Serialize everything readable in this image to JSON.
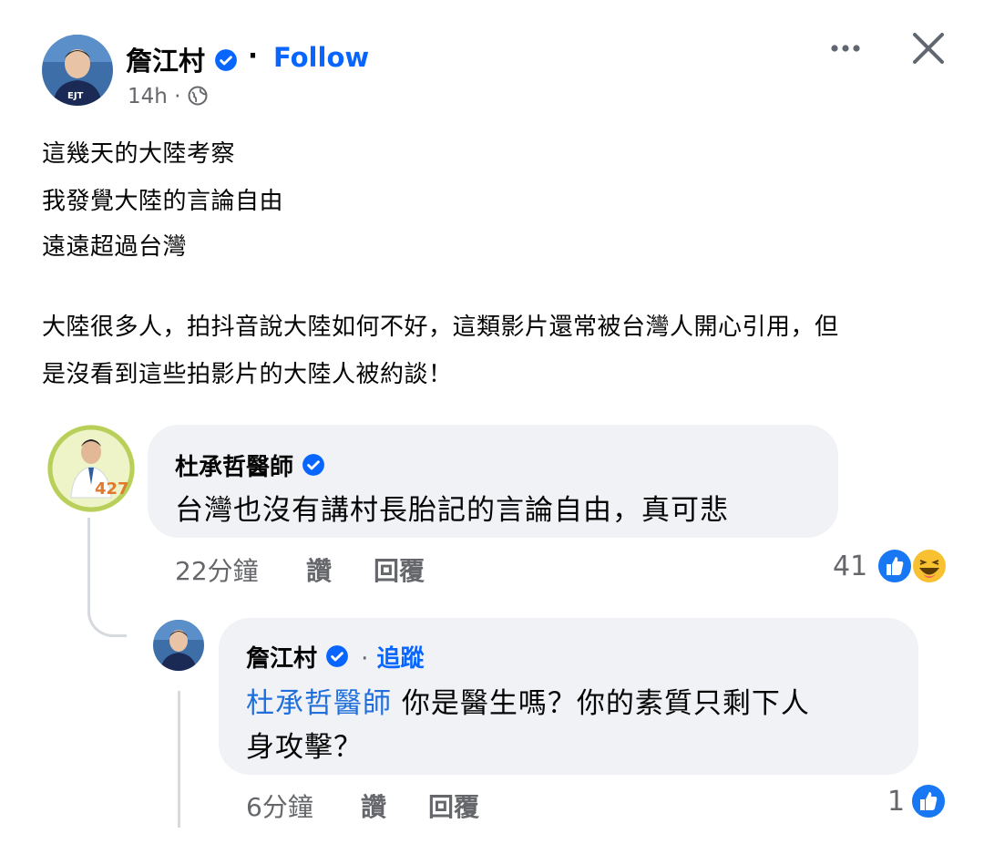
{
  "post": {
    "author": "詹江村",
    "separator": "·",
    "follow_label": "Follow",
    "time": "14h",
    "time_dot": "·",
    "lines": [
      "這幾天的大陸考察",
      "我發覺大陸的言論自由",
      "遠遠超過台灣",
      "大陸很多人，拍抖音說大陸如何不好，這類影片還常被台灣人開心引用，但",
      "是沒看到這些拍影片的大陸人被約談！"
    ]
  },
  "comment1": {
    "author": "杜承哲醫師",
    "text": "台灣也沒有講村長胎記的言論自由，真可悲",
    "time": "22分鐘",
    "like_label": "讚",
    "reply_label": "回覆",
    "reaction_count": "41",
    "avatar_badge": "427"
  },
  "reply1": {
    "author": "詹江村",
    "separator": "·",
    "follow_label": "追蹤",
    "mention": "杜承哲醫師",
    "text_line1": " 你是醫生嗎？你的素質只剩下人",
    "text_line2": "身攻擊？",
    "time": "6分鐘",
    "like_label": "讚",
    "reply_label": "回覆",
    "reaction_count": "1"
  },
  "colors": {
    "accent": "#0866ff",
    "bubble": "#f0f2f5",
    "muted": "#65676b"
  }
}
